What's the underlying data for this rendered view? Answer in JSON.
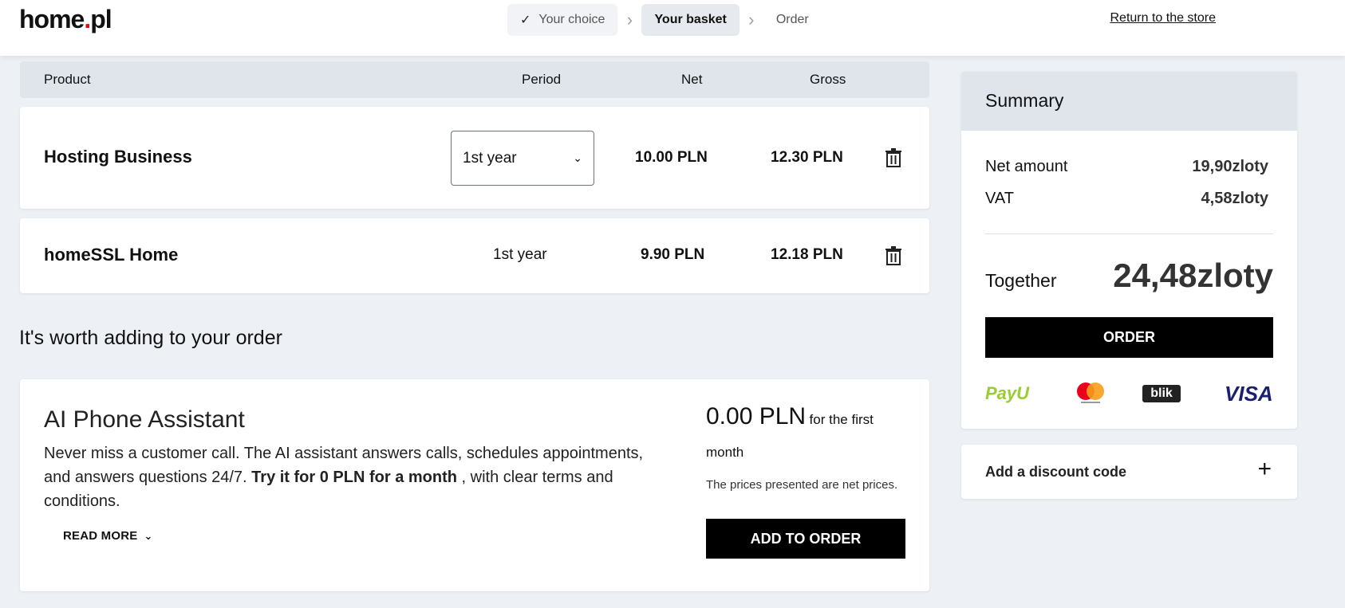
{
  "header": {
    "logo_left": "home",
    "logo_dot": ".",
    "logo_right": "pl",
    "steps": [
      {
        "label": "Your choice",
        "state": "done"
      },
      {
        "label": "Your basket",
        "state": "active"
      },
      {
        "label": "Order",
        "state": "pending"
      }
    ],
    "return_link": "Return to the store"
  },
  "table": {
    "headers": {
      "product": "Product",
      "period": "Period",
      "net": "Net",
      "gross": "Gross"
    },
    "rows": [
      {
        "name": "Hosting Business",
        "period": "1st year",
        "net": "10.00 PLN",
        "gross": "12.30 PLN"
      },
      {
        "name": "homeSSL Home",
        "period": "1st year",
        "net": "9.90 PLN",
        "gross": "12.18 PLN"
      }
    ]
  },
  "upsell": {
    "section_title": "It's worth adding to your order",
    "title": "AI Phone Assistant",
    "desc_part1": "Never miss a customer call. The AI assistant answers calls, schedules appointments, and answers questions 24/7.",
    "desc_bold": "Try it for 0 PLN for a month",
    "desc_part2": ", with clear terms and conditions.",
    "read_more": "READ MORE",
    "price": "0.00 PLN",
    "price_suffix": "for the first",
    "price_suffix2": "month",
    "net_note": "The prices presented are net prices.",
    "add_button": "ADD TO ORDER"
  },
  "summary": {
    "title": "Summary",
    "net_label": "Net amount",
    "net_value": "19,90zloty",
    "vat_label": "VAT",
    "vat_value": "4,58zloty",
    "together_label": "Together",
    "together_value": "24,48zloty",
    "order_button": "ORDER",
    "payments": {
      "payu": "PayU",
      "blik": "blik",
      "visa": "VISA"
    },
    "discount_label": "Add a discount code"
  },
  "colors": {
    "accent": "#000000",
    "logo_dot": "#e30613",
    "panel_head": "#e0e5ec",
    "background": "#edf0f4"
  }
}
